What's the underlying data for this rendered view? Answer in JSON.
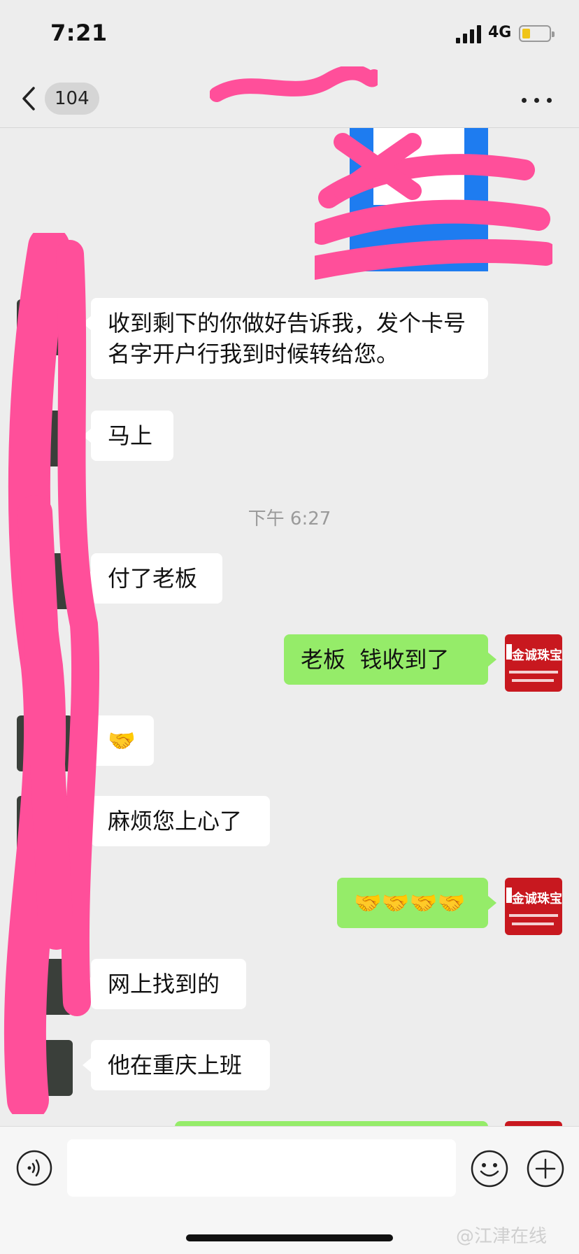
{
  "status_bar": {
    "time": "7:21",
    "network": "4G",
    "battery_level": 0.3
  },
  "nav": {
    "back_count": "104",
    "title": ""
  },
  "messages": [
    {
      "side": "in",
      "text": "收到剩下的你做好告诉我，发个卡号名字开户行我到时候转给您。"
    },
    {
      "side": "in",
      "text": "马上"
    },
    {
      "type": "time",
      "text": "下午 6:27"
    },
    {
      "side": "in",
      "text": "付了老板"
    },
    {
      "side": "out",
      "text": "老板  钱收到了"
    },
    {
      "side": "in",
      "text": "🤝"
    },
    {
      "side": "in",
      "text": "麻烦您上心了"
    },
    {
      "side": "out",
      "text": "🤝🤝🤝🤝"
    },
    {
      "side": "in",
      "text": "网上找到的"
    },
    {
      "side": "in",
      "text": "他在重庆上班"
    }
  ],
  "self_avatar": {
    "text": "金诚珠宝",
    "color": "#c8181f"
  },
  "input": {
    "placeholder": ""
  },
  "watermark": "@江津在线",
  "colors": {
    "out_bubble": "#95ec69",
    "in_bubble": "#ffffff",
    "redaction": "#ff4f9a"
  }
}
